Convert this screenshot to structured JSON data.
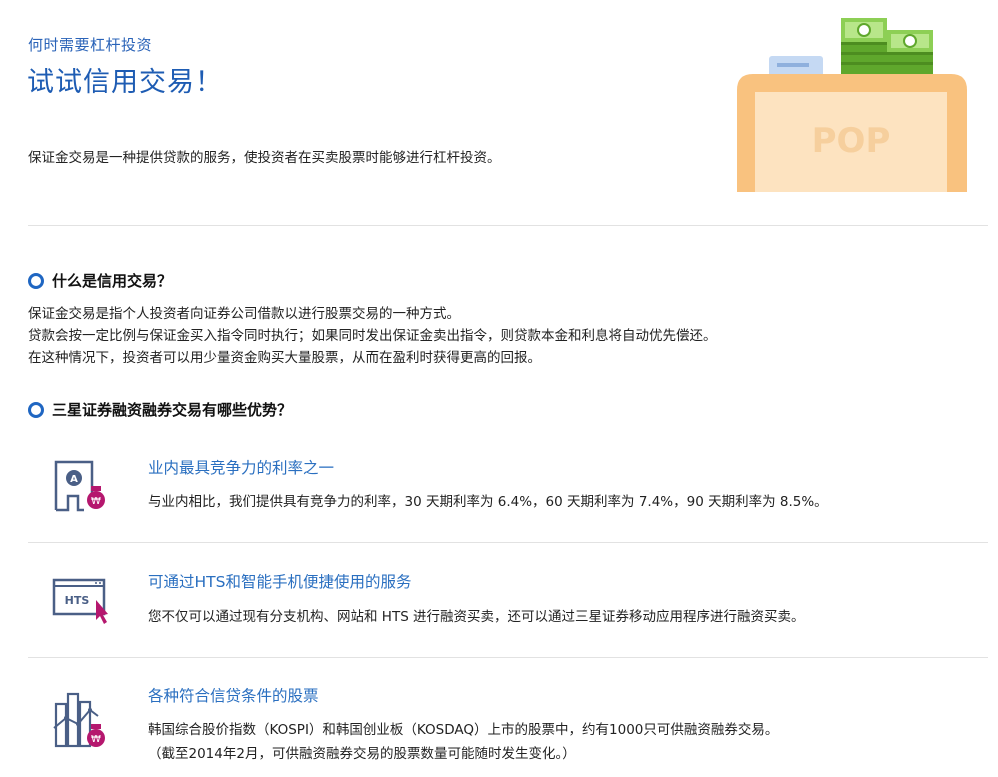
{
  "hero": {
    "subtitle": "何时需要杠杆投资",
    "title": "试试信用交易！",
    "description": "保证金交易是一种提供贷款的服务，使投资者在买卖股票时能够进行杠杆投资。",
    "logo_text": "POP"
  },
  "section1": {
    "heading": "什么是信用交易？",
    "lines": [
      "保证金交易是指个人投资者向证券公司借款以进行股票交易的一种方式。",
      "贷款会按一定比例与保证金买入指令同时执行；如果同时发出保证金卖出指令，则贷款本金和利息将自动优先偿还。",
      "在这种情况下，投资者可以用少量资金购买大量股票，从而在盈利时获得更高的回报。"
    ]
  },
  "section2": {
    "heading": "三星证券融资融券交易有哪些优势？",
    "features": [
      {
        "title": "业内最具竞争力的利率之一",
        "desc": [
          "与业内相比，我们提供具有竞争力的利率，30 天期利率为 6.4%，60 天期利率为 7.4%，90 天期利率为 8.5%。"
        ],
        "icon_label": "A",
        "badge": "₩"
      },
      {
        "title": "可通过HTS和智能手机便捷使用的服务",
        "desc": [
          "您不仅可以通过现有分支机构、网站和 HTS 进行融资买卖，还可以通过三星证券移动应用程序进行融资买卖。"
        ],
        "icon_label": "HTS"
      },
      {
        "title": "各种符合信贷条件的股票",
        "desc": [
          "韩国综合股价指数（KOSPI）和韩国创业板（KOSDAQ）上市的股票中，约有1000只可供融资融券交易。",
          "（截至2014年2月，可供融资融券交易的股票数量可能随时发生变化。）"
        ],
        "badge": "₩"
      }
    ]
  },
  "colors": {
    "accent_blue": "#1e5cb3",
    "link_blue": "#2a6fc0",
    "badge_magenta": "#b5176e",
    "box_orange": "#f9c27f",
    "money_green": "#7cc243"
  }
}
